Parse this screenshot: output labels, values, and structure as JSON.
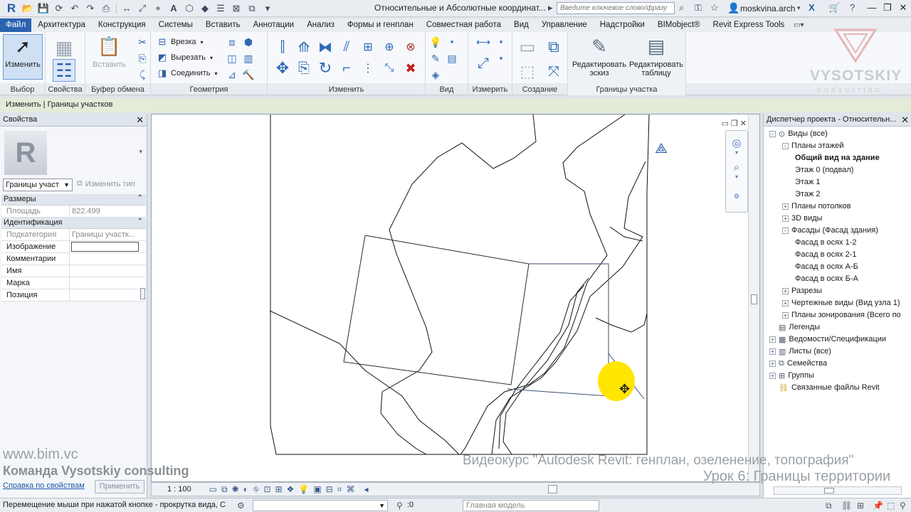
{
  "titlebar": {
    "app_logo": "R",
    "document_title": "Относительные и Абсолютные координат...",
    "search_placeholder": "Введите ключевое слово/фразу",
    "user_name": "moskvina.arch"
  },
  "ribbon_tabs": [
    "Файл",
    "Архитектура",
    "Конструкция",
    "Системы",
    "Вставить",
    "Аннотации",
    "Анализ",
    "Формы и генплан",
    "Совместная работа",
    "Вид",
    "Управление",
    "Надстройки",
    "BIMobject®",
    "Revit Express Tools"
  ],
  "ribbon": {
    "modify_label": "Изменить",
    "panels": {
      "select": "Выбор",
      "properties": "Свойства",
      "clipboard": "Буфер обмена",
      "geometry": "Геометрия",
      "modify": "Изменить",
      "view": "Вид",
      "measure": "Измерить",
      "create": "Создание",
      "property_lines": "Границы участка"
    },
    "paste_label": "Вставить",
    "geometry_cmds": [
      "Врезка",
      "Вырезать",
      "Соединить"
    ],
    "edit_sketch": "Редактировать эскиз",
    "edit_table": "Редактировать таблицу"
  },
  "context_bar": "Изменить | Границы участков",
  "properties": {
    "title": "Свойства",
    "type_preview_letter": "R",
    "type_selector": "Границы участ",
    "edit_type": "Изменить тип",
    "groups": [
      {
        "name": "Размеры",
        "rows": [
          {
            "name": "Площадь",
            "value": "822.499",
            "readonly": true
          }
        ]
      },
      {
        "name": "Идентификация",
        "rows": [
          {
            "name": "Подкатегория",
            "value": "Границы участк...",
            "readonly": true
          },
          {
            "name": "Изображение",
            "value": "",
            "readonly": false
          },
          {
            "name": "Комментарии",
            "value": "",
            "readonly": false
          },
          {
            "name": "Имя",
            "value": "",
            "readonly": false
          },
          {
            "name": "Марка",
            "value": "",
            "readonly": false
          },
          {
            "name": "Позиция",
            "value": "",
            "readonly": false
          }
        ]
      }
    ],
    "help_link": "Справка по свойствам",
    "apply_label": "Применить"
  },
  "view_control": {
    "scale": "1 : 100"
  },
  "project_browser": {
    "title": "Диспетчер проекта - Относительн...",
    "items": [
      {
        "label": "Виды (все)",
        "level": 0,
        "toggle": "-",
        "icon": "views"
      },
      {
        "label": "Планы этажей",
        "level": 1,
        "toggle": "-"
      },
      {
        "label": "Общий вид на здание",
        "level": 2,
        "bold": true
      },
      {
        "label": "Этаж 0 (подвал)",
        "level": 2
      },
      {
        "label": "Этаж 1",
        "level": 2
      },
      {
        "label": "Этаж 2",
        "level": 2
      },
      {
        "label": "Планы потолков",
        "level": 1,
        "toggle": "+"
      },
      {
        "label": "3D виды",
        "level": 1,
        "toggle": "+"
      },
      {
        "label": "Фасады (Фасад здания)",
        "level": 1,
        "toggle": "-"
      },
      {
        "label": "Фасад в осях 1-2",
        "level": 2
      },
      {
        "label": "Фасад в осях 2-1",
        "level": 2
      },
      {
        "label": "Фасад в осях А-Б",
        "level": 2
      },
      {
        "label": "Фасад в осях Б-А",
        "level": 2
      },
      {
        "label": "Разрезы",
        "level": 1,
        "toggle": "+"
      },
      {
        "label": "Чертежные виды (Вид узла 1)",
        "level": 1,
        "toggle": "+"
      },
      {
        "label": "Планы зонирования (Всего по",
        "level": 1,
        "toggle": "+"
      },
      {
        "label": "Легенды",
        "level": 0,
        "icon": "legend"
      },
      {
        "label": "Ведомости/Спецификации",
        "level": 0,
        "toggle": "+",
        "icon": "schedule"
      },
      {
        "label": "Листы (все)",
        "level": 0,
        "toggle": "+",
        "icon": "sheets"
      },
      {
        "label": "Семейства",
        "level": 0,
        "toggle": "+",
        "icon": "families"
      },
      {
        "label": "Группы",
        "level": 0,
        "toggle": "+",
        "icon": "groups"
      },
      {
        "label": "Связанные файлы Revit",
        "level": 0,
        "icon": "links"
      }
    ]
  },
  "watermark": {
    "brand": "VYSOTSKIY",
    "brand_sub": "CONSULTING",
    "site": "www.bim.vc",
    "team": "Команда Vysotskiy consulting",
    "course": "Видеокурс \"Autodesk Revit: генплан, озеленение, топография\"",
    "lesson": "Урок 6: Границы территории"
  },
  "statusbar": {
    "message": "Перемещение мыши при нажатой кнопке - прокрутка вида, С",
    "selection_count": ":0",
    "model": "Главная модель"
  }
}
